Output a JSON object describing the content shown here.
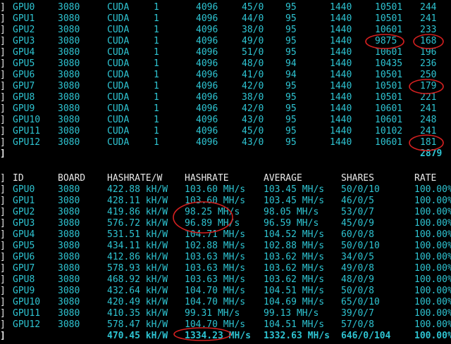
{
  "prefix": "]",
  "top_table": {
    "rows": [
      [
        "GPU0",
        "3080",
        "CUDA",
        "1",
        "4096",
        "45/0",
        "95",
        "1440",
        "10501",
        "244"
      ],
      [
        "GPU1",
        "3080",
        "CUDA",
        "1",
        "4096",
        "44/0",
        "95",
        "1440",
        "10501",
        "241"
      ],
      [
        "GPU2",
        "3080",
        "CUDA",
        "1",
        "4096",
        "38/0",
        "95",
        "1440",
        "10601",
        "233"
      ],
      [
        "GPU3",
        "3080",
        "CUDA",
        "1",
        "4096",
        "49/0",
        "95",
        "1440",
        "9875",
        "168"
      ],
      [
        "GPU4",
        "3080",
        "CUDA",
        "1",
        "4096",
        "51/0",
        "95",
        "1440",
        "10601",
        "196"
      ],
      [
        "GPU5",
        "3080",
        "CUDA",
        "1",
        "4096",
        "48/0",
        "94",
        "1440",
        "10435",
        "236"
      ],
      [
        "GPU6",
        "3080",
        "CUDA",
        "1",
        "4096",
        "41/0",
        "94",
        "1440",
        "10501",
        "250"
      ],
      [
        "GPU7",
        "3080",
        "CUDA",
        "1",
        "4096",
        "42/0",
        "95",
        "1440",
        "10501",
        "179"
      ],
      [
        "GPU8",
        "3080",
        "CUDA",
        "1",
        "4096",
        "38/0",
        "95",
        "1440",
        "10501",
        "221"
      ],
      [
        "GPU9",
        "3080",
        "CUDA",
        "1",
        "4096",
        "42/0",
        "95",
        "1440",
        "10601",
        "241"
      ],
      [
        "GPU10",
        "3080",
        "CUDA",
        "1",
        "4096",
        "43/0",
        "95",
        "1440",
        "10601",
        "248"
      ],
      [
        "GPU11",
        "3080",
        "CUDA",
        "1",
        "4096",
        "45/0",
        "95",
        "1440",
        "10102",
        "241"
      ],
      [
        "GPU12",
        "3080",
        "CUDA",
        "1",
        "4096",
        "43/0",
        "95",
        "1440",
        "10601",
        "181"
      ]
    ],
    "total": "2879"
  },
  "bottom_table": {
    "headers": [
      "ID",
      "BOARD",
      "HASHRATE/W",
      "HASHRATE",
      "AVERAGE",
      "SHARES",
      "RATE"
    ],
    "rows": [
      [
        "GPU0",
        "3080",
        "422.88 kH/W",
        "103.60 MH/s",
        "103.45 MH/s",
        "50/0/10",
        "100.00%"
      ],
      [
        "GPU1",
        "3080",
        "428.11 kH/W",
        "103.60 MH/s",
        "103.45 MH/s",
        "46/0/5",
        "100.00%"
      ],
      [
        "GPU2",
        "3080",
        "419.86 kH/W",
        "98.25 MH/s",
        "98.05 MH/s",
        "53/0/7",
        "100.00%"
      ],
      [
        "GPU3",
        "3080",
        "576.72 kH/W",
        "96.89 MH/s",
        "96.59 MH/s",
        "45/0/9",
        "100.00%"
      ],
      [
        "GPU4",
        "3080",
        "531.51 kH/W",
        "104.71 MH/s",
        "104.52 MH/s",
        "60/0/8",
        "100.00%"
      ],
      [
        "GPU5",
        "3080",
        "434.11 kH/W",
        "102.88 MH/s",
        "102.88 MH/s",
        "50/0/10",
        "100.00%"
      ],
      [
        "GPU6",
        "3080",
        "412.86 kH/W",
        "103.63 MH/s",
        "103.62 MH/s",
        "34/0/5",
        "100.00%"
      ],
      [
        "GPU7",
        "3080",
        "578.93 kH/W",
        "103.63 MH/s",
        "103.62 MH/s",
        "49/0/8",
        "100.00%"
      ],
      [
        "GPU8",
        "3080",
        "468.92 kH/W",
        "103.63 MH/s",
        "103.62 MH/s",
        "48/0/9",
        "100.00%"
      ],
      [
        "GPU9",
        "3080",
        "432.64 kH/W",
        "104.70 MH/s",
        "104.51 MH/s",
        "50/0/8",
        "100.00%"
      ],
      [
        "GPU10",
        "3080",
        "420.49 kH/W",
        "104.70 MH/s",
        "104.69 MH/s",
        "65/0/10",
        "100.00%"
      ],
      [
        "GPU11",
        "3080",
        "410.35 kH/W",
        "99.31 MH/s",
        "99.13 MH/s",
        "39/0/7",
        "100.00%"
      ],
      [
        "GPU12",
        "3080",
        "578.47 kH/W",
        "104.70 MH/s",
        "104.51 MH/s",
        "57/0/8",
        "100.00%"
      ]
    ],
    "totals": [
      "",
      "",
      "470.45 kH/W",
      "1334.23 MH/s",
      "1332.63 MH/s",
      "646/0/104",
      "100.00%"
    ]
  },
  "annotation_color": "#d42020"
}
